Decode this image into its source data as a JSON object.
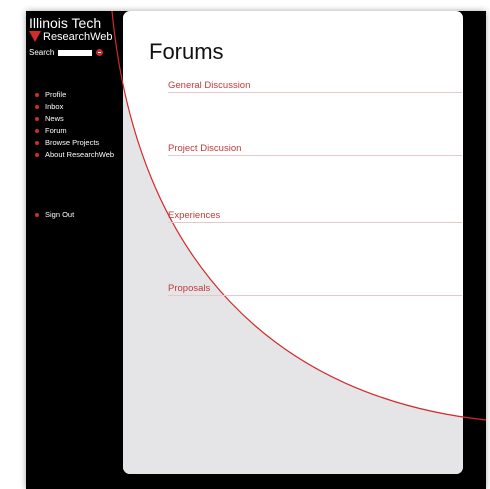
{
  "brand": {
    "line1": "Illinois Tech",
    "line2": "ResearchWeb"
  },
  "search": {
    "label": "Search",
    "value": ""
  },
  "nav": {
    "items": [
      "Profile",
      "Inbox",
      "News",
      "Forum",
      "Browse Projects",
      "About ResearchWeb"
    ],
    "sign_out": "Sign Out"
  },
  "page": {
    "title": "Forums"
  },
  "forums": [
    "General Discussion",
    "Project Discusion",
    "Experiences",
    "Proposals"
  ],
  "colors": {
    "accent": "#d12b2b",
    "link": "#c03a3a",
    "sidebar": "#000000",
    "panel": "#ffffff",
    "curve_fill": "#e5e4e6"
  },
  "icons": {
    "brand": "red-triangle-icon",
    "search_go": "search-go-icon",
    "nav_bullet": "red-dot-icon"
  }
}
